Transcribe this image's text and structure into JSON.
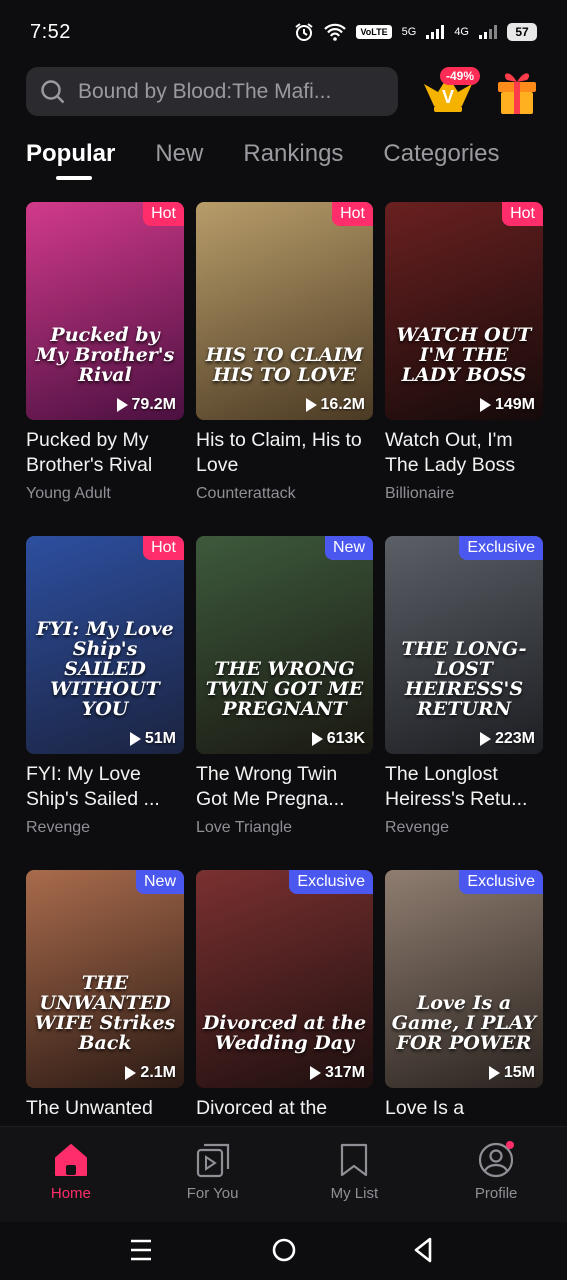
{
  "status": {
    "time": "7:52",
    "battery": "57",
    "volte": "VoLTE",
    "net1": "5G",
    "net2": "4G"
  },
  "search": {
    "placeholder": "Bound by Blood:The Mafi..."
  },
  "vip": {
    "discount": "-49%"
  },
  "tabs": [
    "Popular",
    "New",
    "Rankings",
    "Categories"
  ],
  "cards": [
    {
      "title": "Pucked by My Brother's Rival",
      "genre": "Young Adult",
      "badge": "Hot",
      "views": "79.2M",
      "poster_text": "Pucked by My Brother's Rival",
      "c1": "#d23a8a",
      "c2": "#4a1040"
    },
    {
      "title": "His to Claim, His to Love",
      "genre": "Counterattack",
      "badge": "Hot",
      "views": "16.2M",
      "poster_text": "HIS TO CLAIM HIS TO LOVE",
      "c1": "#b89d6a",
      "c2": "#4b3a24"
    },
    {
      "title": "Watch Out, I'm The Lady Boss",
      "genre": "Billionaire",
      "badge": "Hot",
      "views": "149M",
      "poster_text": "WATCH OUT I'M THE LADY BOSS",
      "c1": "#6a2020",
      "c2": "#150a0a"
    },
    {
      "title": "FYI: My Love Ship's Sailed ...",
      "genre": "Revenge",
      "badge": "Hot",
      "views": "51M",
      "poster_text": "FYI: My Love Ship's SAILED WITHOUT YOU",
      "c1": "#2d4fa0",
      "c2": "#1b2340"
    },
    {
      "title": "The Wrong Twin Got Me Pregna...",
      "genre": "Love Triangle",
      "badge": "New",
      "views": "613K",
      "poster_text": "THE WRONG TWIN GOT ME PREGNANT",
      "c1": "#3d5a3c",
      "c2": "#1a1812"
    },
    {
      "title": "The Longlost Heiress's Retu...",
      "genre": "Revenge",
      "badge": "Exclusive",
      "views": "223M",
      "poster_text": "THE LONG-LOST HEIRESS'S RETURN",
      "c1": "#5b5f66",
      "c2": "#1c1e22"
    },
    {
      "title": "The Unwanted",
      "genre": "",
      "badge": "New",
      "views": "2.1M",
      "poster_text": "THE UNWANTED WIFE Strikes Back",
      "c1": "#a96b4c",
      "c2": "#2b1a14"
    },
    {
      "title": "Divorced at the",
      "genre": "",
      "badge": "Exclusive",
      "views": "317M",
      "poster_text": "Divorced at the Wedding Day",
      "c1": "#7a3030",
      "c2": "#1e0f0f"
    },
    {
      "title": "Love Is a",
      "genre": "",
      "badge": "Exclusive",
      "views": "15M",
      "poster_text": "Love Is a Game, I PLAY FOR POWER",
      "c1": "#8f7d70",
      "c2": "#2b2420"
    }
  ],
  "nav": [
    {
      "label": "Home",
      "icon": "home-icon"
    },
    {
      "label": "For You",
      "icon": "play-stack-icon"
    },
    {
      "label": "My List",
      "icon": "bookmark-icon"
    },
    {
      "label": "Profile",
      "icon": "profile-icon"
    }
  ],
  "colors": {
    "accent": "#ff2d6a",
    "badge_blue": "#4b58f0",
    "bg": "#0d0d0f"
  }
}
